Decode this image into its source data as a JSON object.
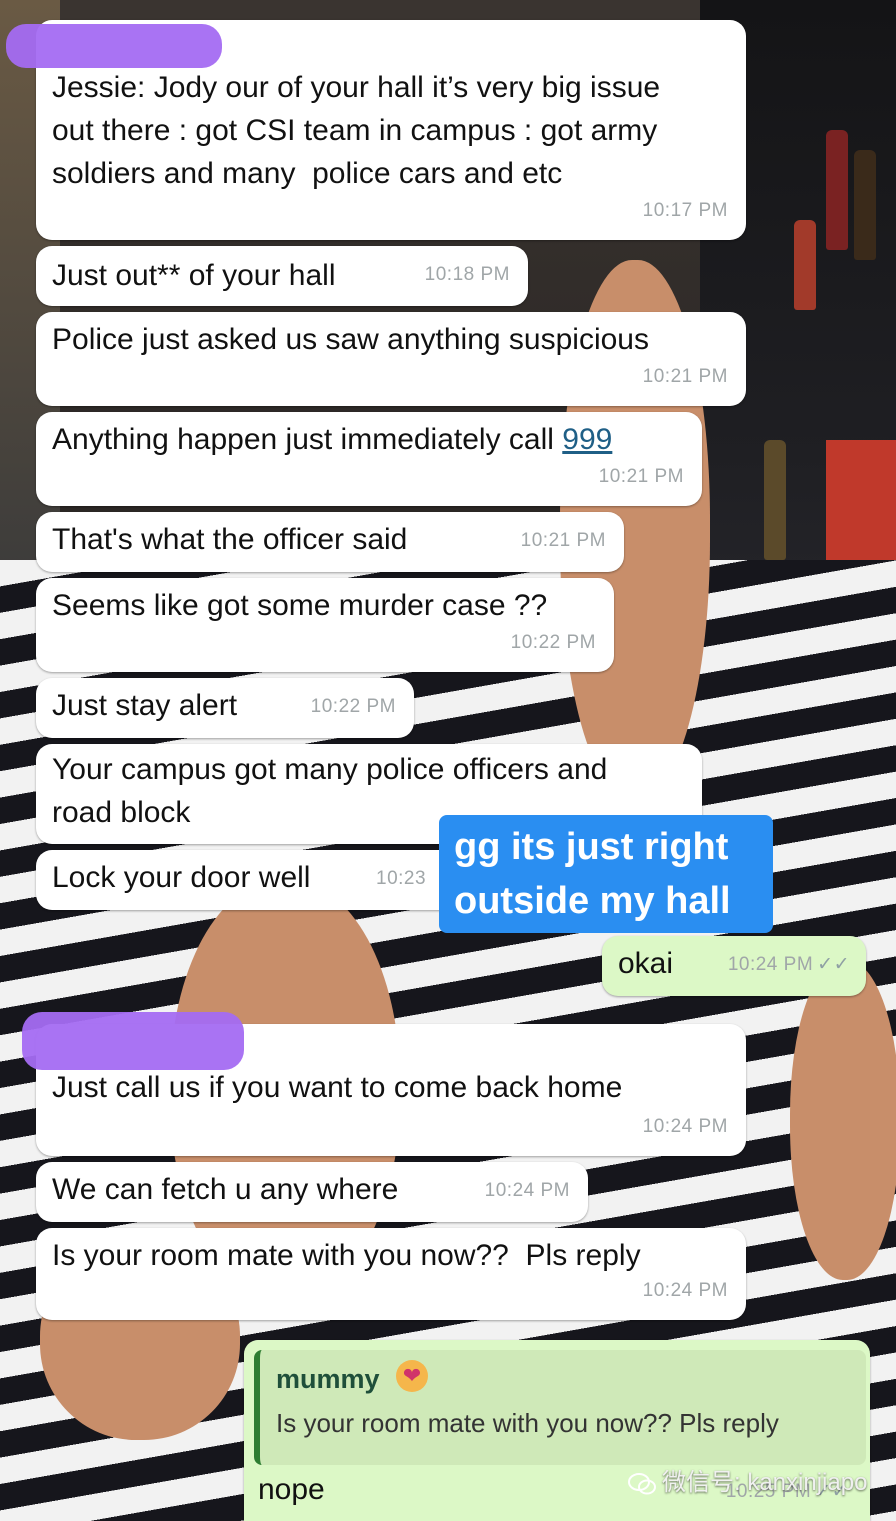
{
  "messages": [
    {
      "text": "Jessie: Jody our of your hall it’s very big issue\nout there : got CSI team in campus : got army\nsoldiers and many  police cars and etc",
      "time": "10:17 PM"
    },
    {
      "text": "Just out** of your hall",
      "time": "10:18 PM"
    },
    {
      "text": "Police just asked us saw anything suspicious",
      "time": "10:21 PM"
    },
    {
      "text": "Anything happen just immediately call ",
      "link": "999",
      "time": "10:21 PM"
    },
    {
      "text": "That's what the officer said",
      "time": "10:21 PM"
    },
    {
      "text": "Seems like got some murder case ??",
      "time": "10:22 PM"
    },
    {
      "text": "Just stay alert",
      "time": "10:22 PM"
    },
    {
      "text": "Your campus got many police officers and\nroad block",
      "time": ""
    },
    {
      "text": "Lock your door well",
      "time": "10:23"
    },
    {
      "text": "Just call us if you want to come back home",
      "time": "10:24 PM"
    },
    {
      "text": "We can fetch u any where",
      "time": "10:24 PM"
    },
    {
      "text": "Is your room mate with you now??  Pls reply",
      "time": "10:24 PM"
    }
  ],
  "outgoing": [
    {
      "text": "okai",
      "time": "10:24 PM",
      "status": "read"
    },
    {
      "text": "nope",
      "time": "10:25 PM",
      "status": "read"
    }
  ],
  "story_caption": {
    "line1": "gg its just right",
    "line2": "outside my hall"
  },
  "reply_quote": {
    "name": "mummy",
    "emoji": "face-blowing-kiss",
    "text": "Is your room mate with you now??  Pls reply"
  },
  "read_tick": "✓✓",
  "watermark": {
    "icon": "wechat-icon",
    "text": "微信号: kanxinjiapo"
  },
  "colors": {
    "incoming": "#ffffff",
    "outgoing": "#dcf8c6",
    "caption": "#2a8ef1",
    "redaction": "#a46bf2"
  }
}
